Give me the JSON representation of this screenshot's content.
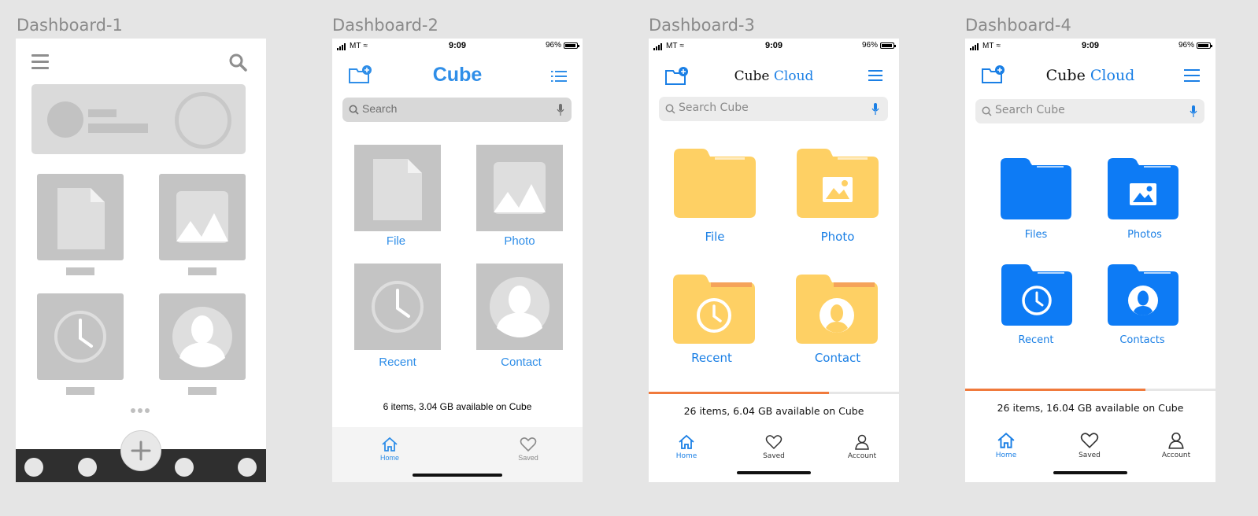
{
  "frames": [
    {
      "title": "Dashboard-1"
    },
    {
      "title": "Dashboard-2"
    },
    {
      "title": "Dashboard-3"
    },
    {
      "title": "Dashboard-4"
    }
  ],
  "status_bar": {
    "carrier": "MT",
    "time": "9:09",
    "battery": "96%"
  },
  "dashboard2": {
    "app_title": "Cube",
    "search_placeholder": "Search",
    "tiles": [
      "File",
      "Photo",
      "Recent",
      "Contact"
    ],
    "storage_text": "6 items, 3.04 GB available on Cube",
    "tabs": [
      "Home",
      "Saved"
    ]
  },
  "dashboard3": {
    "app_title_a": "Cube",
    "app_title_b": "Cloud",
    "search_placeholder": "Search Cube",
    "tiles": [
      "File",
      "Photo",
      "Recent",
      "Contact"
    ],
    "storage_text": "26 items, 6.04 GB available on Cube",
    "storage_used_fraction": 0.72,
    "tabs": [
      "Home",
      "Saved",
      "Account"
    ],
    "folder_color": "#fed064"
  },
  "dashboard4": {
    "app_title_a": "Cube",
    "app_title_b": "Cloud",
    "search_placeholder": "Search Cube",
    "tiles": [
      "Files",
      "Photos",
      "Recent",
      "Contacts"
    ],
    "storage_text": "26 items, 16.04 GB available on Cube",
    "storage_used_fraction": 0.72,
    "tabs": [
      "Home",
      "Saved",
      "Account"
    ],
    "folder_color": "#0d7bf5"
  },
  "colors": {
    "accent": "#1a7fe5",
    "progress": "#f07a3c",
    "wireframe": "#c4c4c4"
  }
}
